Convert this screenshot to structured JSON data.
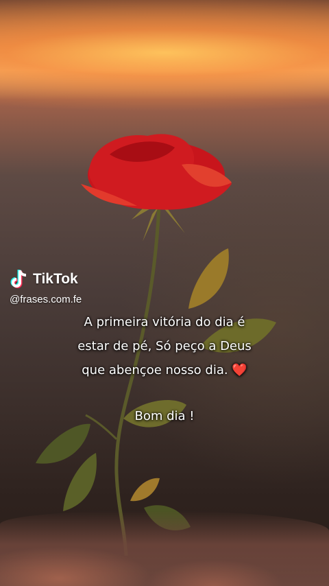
{
  "watermark": {
    "brand": "TikTok",
    "handle": "@frases.com.fe"
  },
  "caption": {
    "line1": "A primeira vitória do dia é",
    "line2": "estar de pé, Só peço a Deus",
    "line3": "que abençoe nosso dia.",
    "heart": "❤️",
    "greeting": "Bom dia !"
  },
  "colors": {
    "rose": "#c9151b",
    "sunset": "#f3b36a"
  }
}
